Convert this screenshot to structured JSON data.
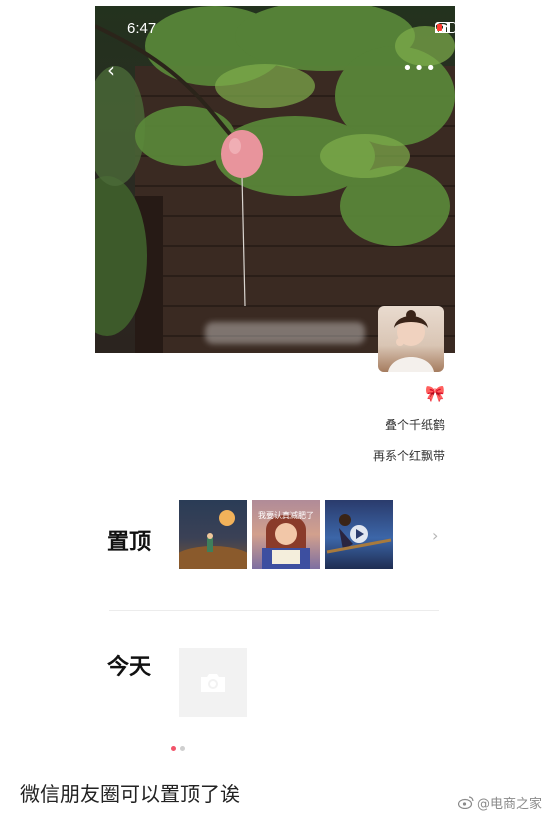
{
  "status_bar": {
    "time": "6:47"
  },
  "profile": {
    "signature_line_1": "叠个千纸鹤",
    "signature_line_2": "再系个红飘带",
    "bow_emoji": "🎀"
  },
  "sections": {
    "pinned": {
      "title": "置顶",
      "thumbnails": [
        {
          "icon": "moon-scene-thumbnail"
        },
        {
          "icon": "reading-girl-thumbnail",
          "caption": "我要认真减肥了"
        },
        {
          "icon": "witch-broom-thumbnail"
        }
      ]
    },
    "today": {
      "title": "今天",
      "icon": "camera-icon"
    }
  },
  "pager": {
    "total": 2,
    "active_index": 0
  },
  "post_caption": "微信朋友圈可以置顶了诶",
  "watermark": {
    "text": "@电商之家"
  },
  "colors": {
    "accent_dot": "#f2546a",
    "balloon": "#e8949c"
  }
}
